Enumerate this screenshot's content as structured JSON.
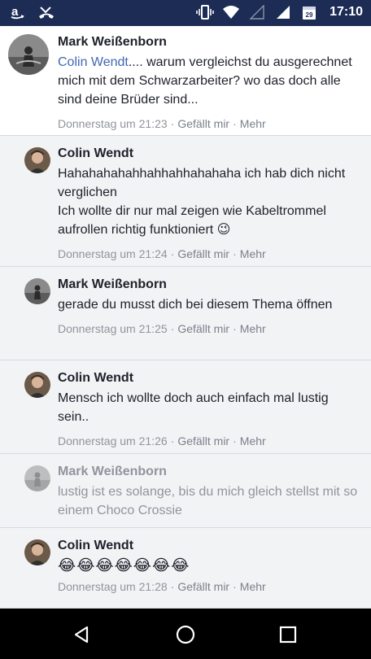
{
  "status_bar": {
    "time": "17:10",
    "icons": [
      "amazon-icon",
      "missed-call-icon",
      "vibrate-icon",
      "wifi-icon",
      "signal-empty-icon",
      "signal-icon",
      "calendar-icon"
    ],
    "calendar_day": "29"
  },
  "comments": [
    {
      "author": "Mark Weißenborn",
      "mention": "Colin Wendt",
      "text": ".... warum vergleichst du ausgerechnet mich mit dem Schwarzarbeiter? wo das doch alle sind deine Brüder sind...",
      "time": "Donnerstag um 21:23",
      "like": "Gefällt mir",
      "more": "Mehr"
    },
    {
      "author": "Colin Wendt",
      "text": "Hahahahahahhahhahhahahaha ich hab dich nicht verglichen\nIch wollte dir nur mal zeigen wie Kabeltrommel aufrollen richtig funktioniert 😉",
      "time": "Donnerstag um 21:24",
      "like": "Gefällt mir",
      "more": "Mehr"
    },
    {
      "author": "Mark Weißenborn",
      "text": "gerade du musst dich bei diesem Thema öffnen",
      "time": "Donnerstag um 21:25",
      "like": "Gefällt mir",
      "more": "Mehr"
    },
    {
      "author": "Colin Wendt",
      "text": "Mensch ich wollte doch auch einfach mal lustig sein..",
      "time": "Donnerstag um 21:26",
      "like": "Gefällt mir",
      "more": "Mehr"
    },
    {
      "author": "Mark Weißenborn",
      "text": "lustig ist es solange, bis du mich gleich stellst mit so einem Choco Crossie"
    },
    {
      "author": "Colin Wendt",
      "text": "😂😂😂😂😂😂😂",
      "time": "Donnerstag um 21:28",
      "like": "Gefällt mir",
      "more": "Mehr"
    }
  ],
  "nav": {
    "icons": [
      "back-icon",
      "home-icon",
      "recents-icon"
    ]
  }
}
